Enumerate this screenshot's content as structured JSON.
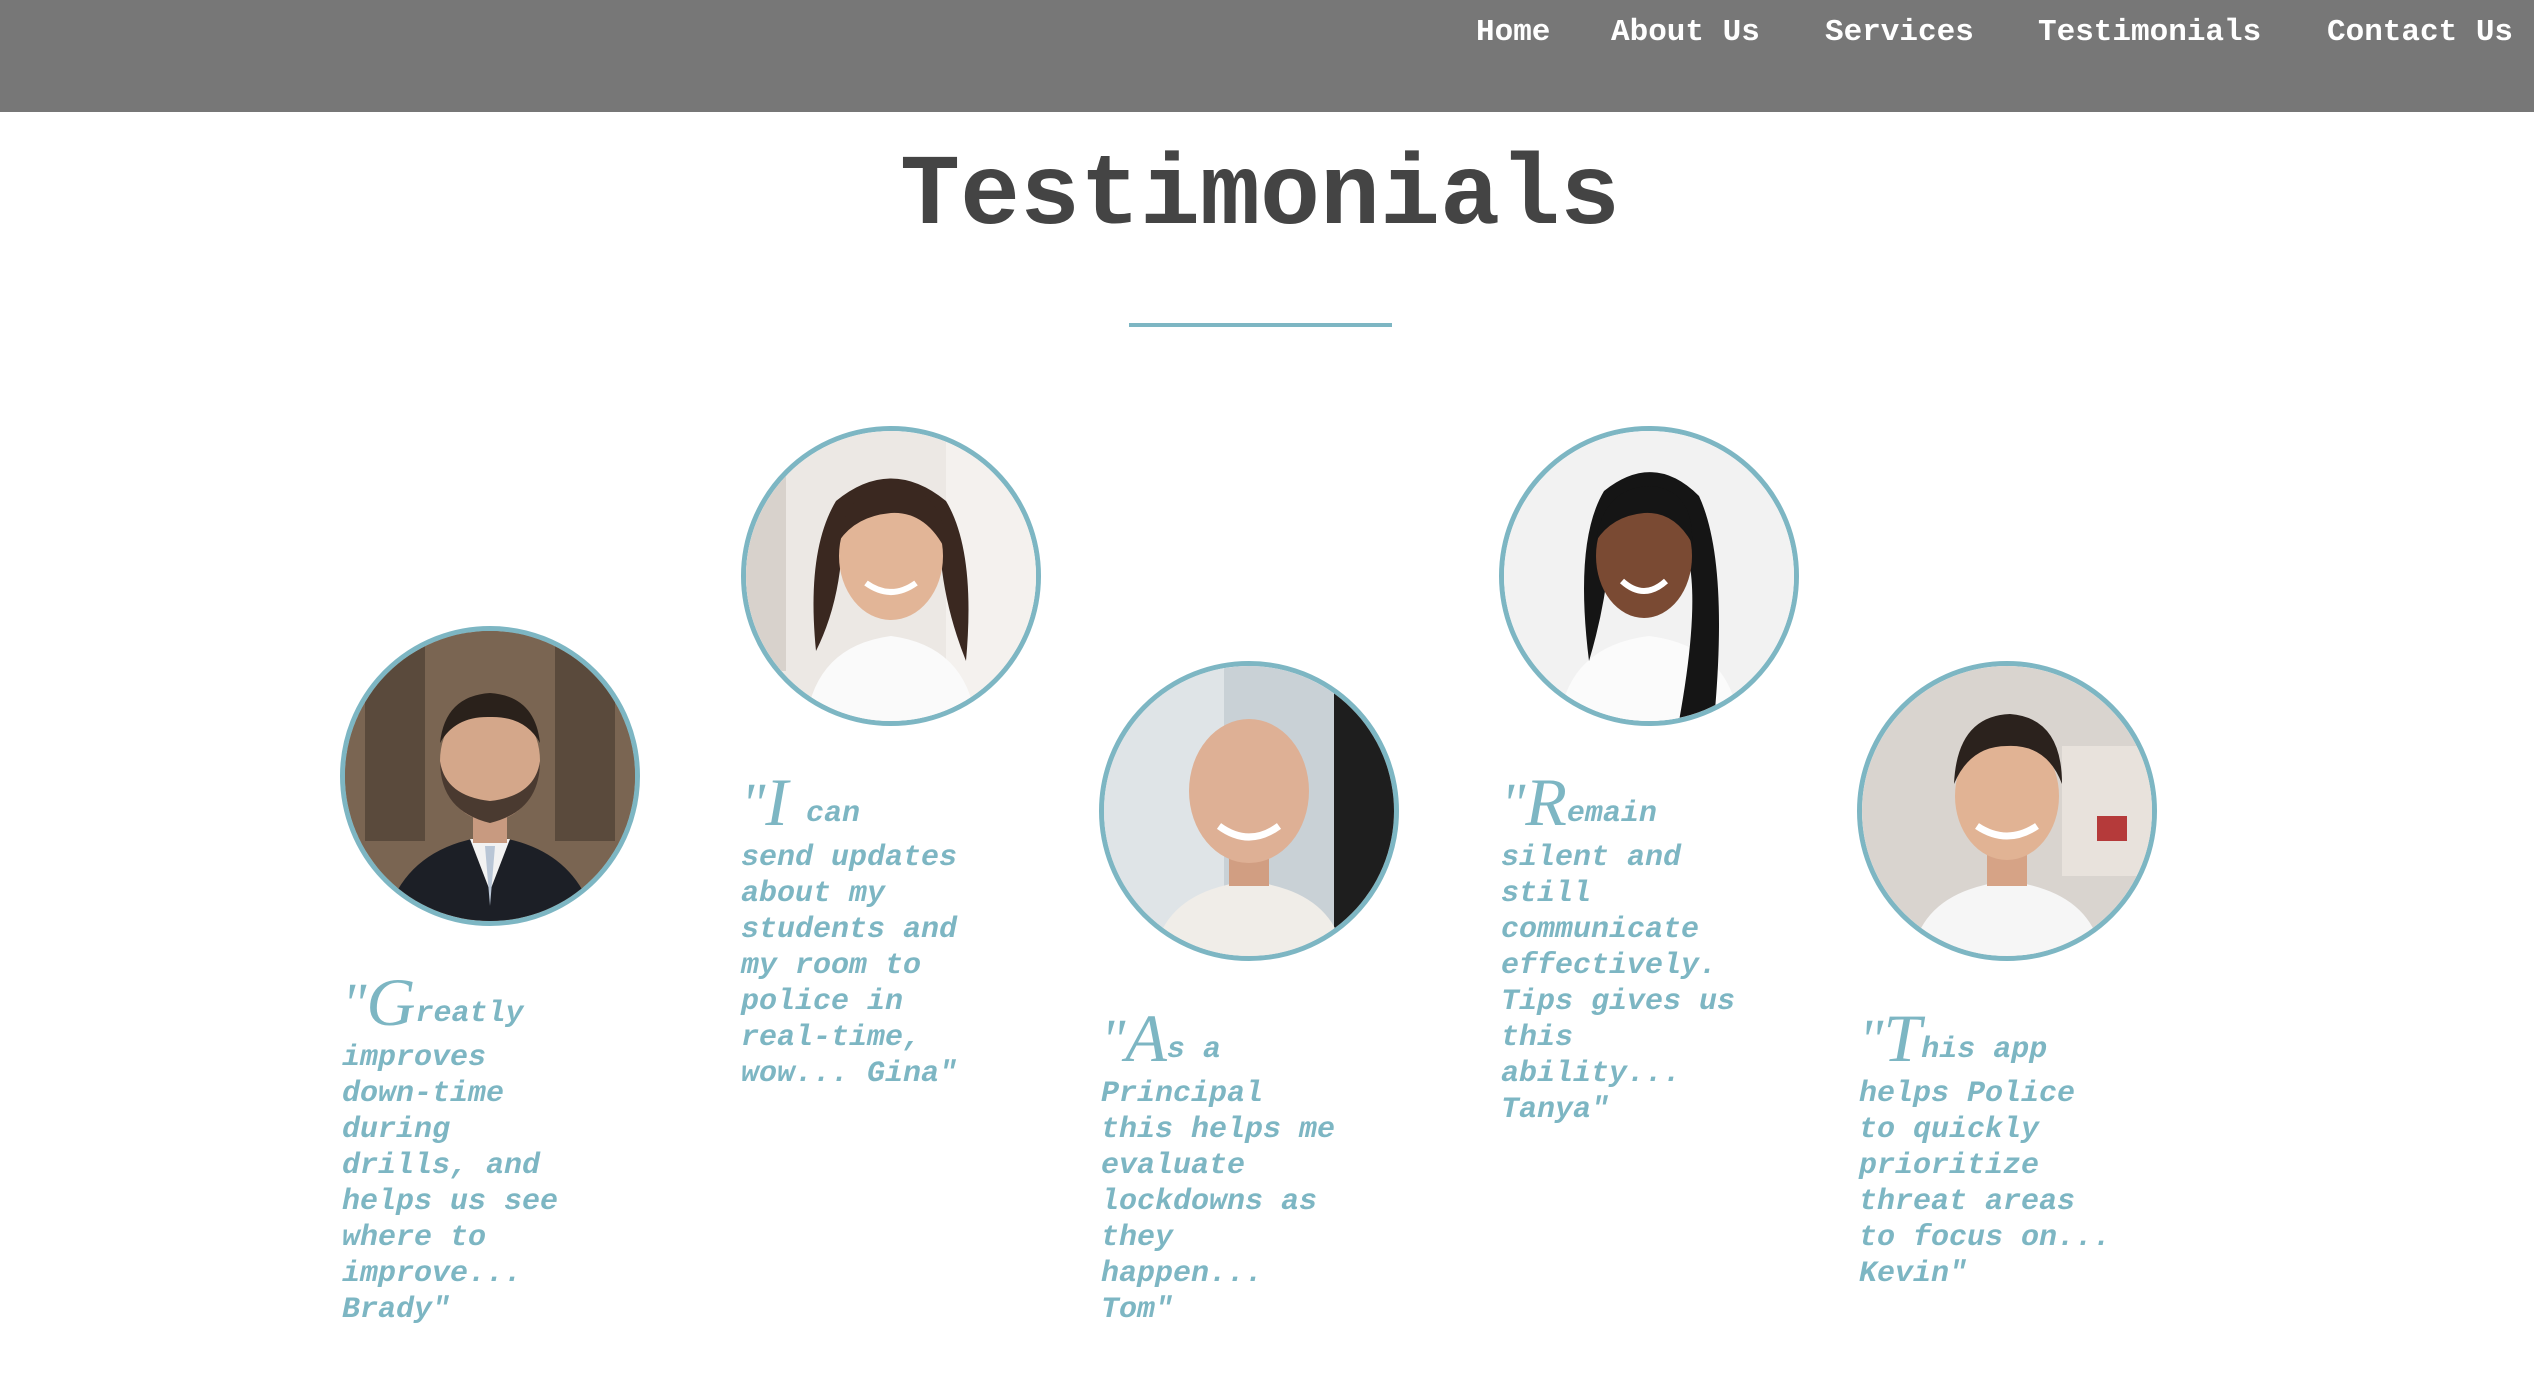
{
  "nav": {
    "items": [
      {
        "label": "Home"
      },
      {
        "label": "About Us"
      },
      {
        "label": "Services"
      },
      {
        "label": "Testimonials"
      },
      {
        "label": "Contact Us"
      }
    ]
  },
  "header": {
    "title": "Testimonials"
  },
  "colors": {
    "navbar": "#777777",
    "accent": "#7db6c3",
    "title": "#444444"
  },
  "testimonials": [
    {
      "open": "\"",
      "initial": "G",
      "lead": "reatly",
      "body": "improves down-time during drills, and helps us see where to improve... Brady\""
    },
    {
      "open": "\"",
      "initial": "I",
      "lead": " can",
      "body": "send updates about my students and my room to police in real-time, wow... Gina\""
    },
    {
      "open": "\"",
      "initial": "A",
      "lead": "s a",
      "body": "Principal this helps me evaluate lockdowns as they happen... Tom\""
    },
    {
      "open": "\"",
      "initial": "R",
      "lead": "emain",
      "body": "silent and still communicate effectively. Tips gives us this ability... Tanya\""
    },
    {
      "open": "\"",
      "initial": "T",
      "lead": "his app",
      "body": "helps Police to quickly prioritize threat areas to focus on... Kevin\""
    }
  ]
}
